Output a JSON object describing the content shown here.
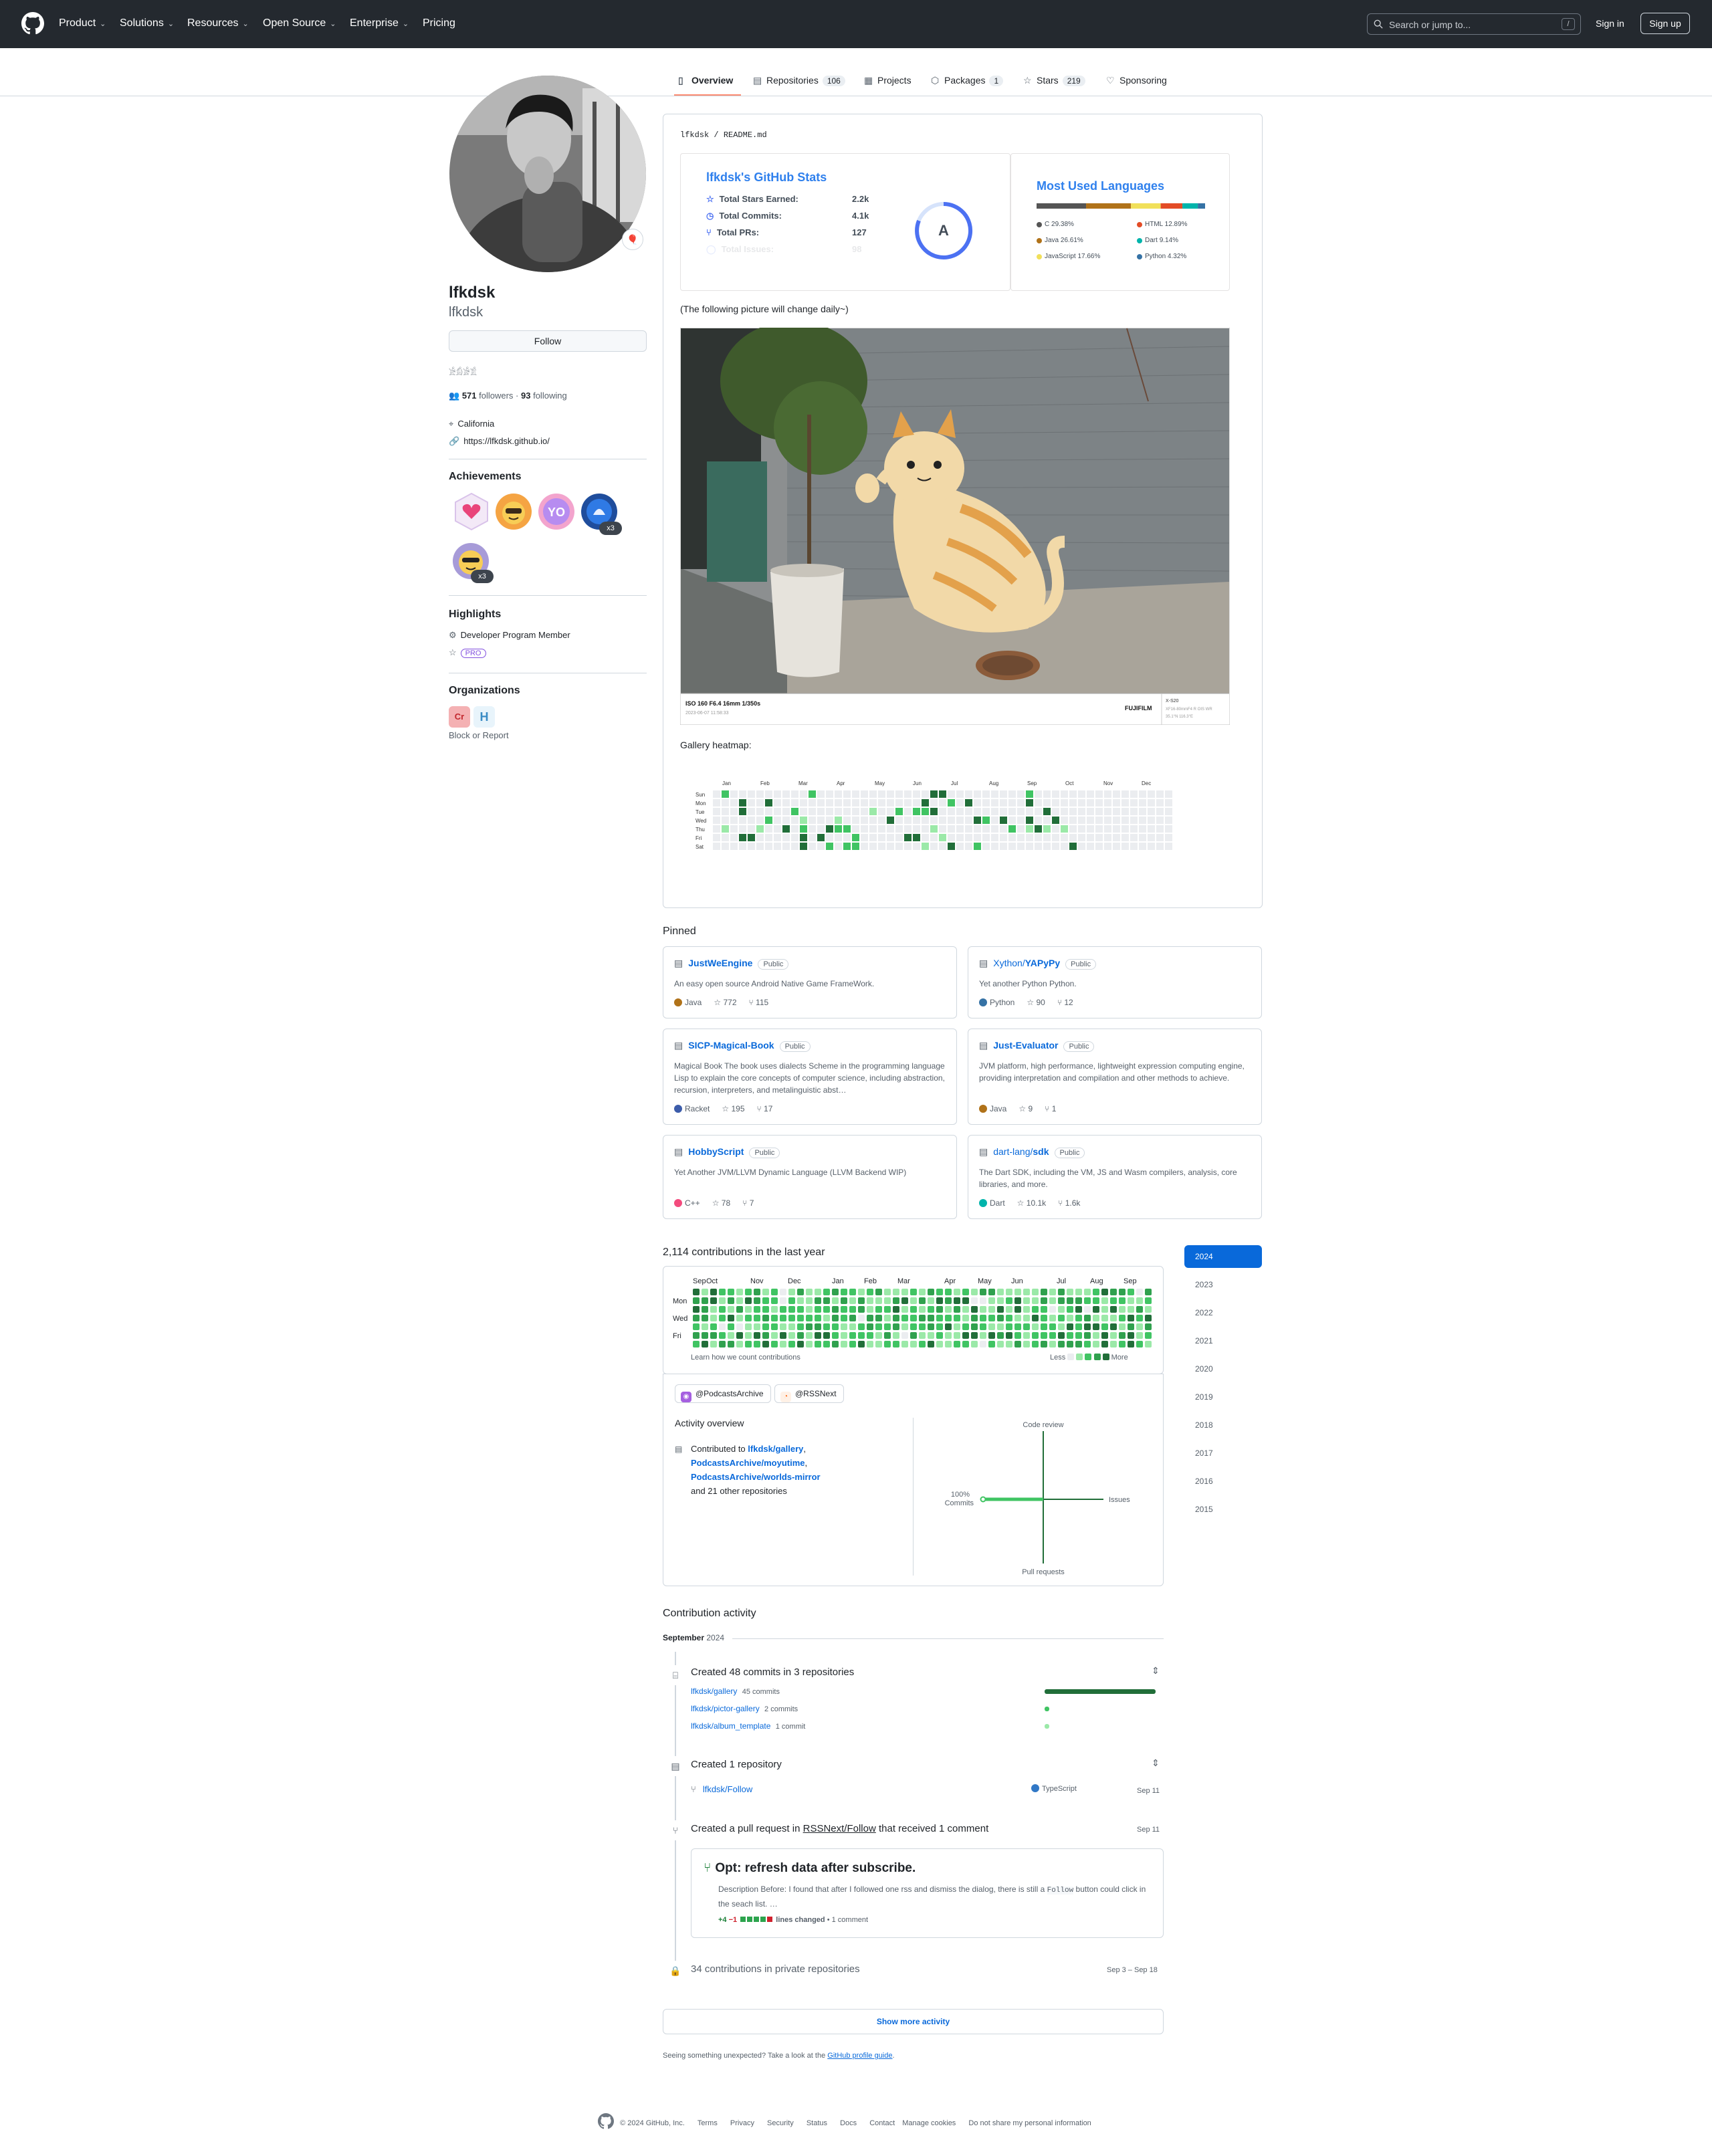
{
  "header": {
    "nav": [
      "Product",
      "Solutions",
      "Resources",
      "Open Source",
      "Enterprise",
      "Pricing"
    ],
    "search_placeholder": "Search or jump to...",
    "search_kbd": "/",
    "sign_in": "Sign in",
    "sign_up": "Sign up"
  },
  "tabs": [
    {
      "label": "Overview"
    },
    {
      "label": "Repositories",
      "count": "106"
    },
    {
      "label": "Projects"
    },
    {
      "label": "Packages",
      "count": "1"
    },
    {
      "label": "Stars",
      "count": "219"
    },
    {
      "label": "Sponsoring"
    }
  ],
  "profile": {
    "name": "lfkdsk",
    "login": "lfkdsk",
    "follow": "Follow",
    "bio": "𓀀𓀁𓀂𓀃",
    "followers": "571",
    "followers_label": "followers",
    "following": "93",
    "following_label": "following",
    "location": "California",
    "website": "https://lfkdsk.github.io/",
    "achievements_title": "Achievements",
    "achievement_counts": [
      "x3",
      "x3"
    ],
    "highlights_title": "Highlights",
    "highlight_member": "Developer Program Member",
    "highlight_pro": "PRO",
    "orgs_title": "Organizations",
    "block": "Block or Report"
  },
  "readme": {
    "path_owner": "lfkdsk",
    "path_file": "README.md",
    "note": "(The following picture will change daily~)",
    "heatmap_title": "Gallery heatmap:",
    "stats": {
      "title": "lfkdsk's GitHub Stats",
      "rows": [
        {
          "label": "Total Stars Earned:",
          "value": "2.2k"
        },
        {
          "label": "Total Commits:",
          "value": "4.1k"
        },
        {
          "label": "Total PRs:",
          "value": "127"
        },
        {
          "label": "Total Issues:",
          "value": "98"
        }
      ],
      "grade": "A"
    },
    "langs": {
      "title": "Most Used Languages",
      "items": [
        {
          "name": "C",
          "pct": "29.38%",
          "color": "#555555"
        },
        {
          "name": "Java",
          "pct": "26.61%",
          "color": "#b07219"
        },
        {
          "name": "JavaScript",
          "pct": "17.66%",
          "color": "#f1e05a"
        },
        {
          "name": "HTML",
          "pct": "12.89%",
          "color": "#e34c26"
        },
        {
          "name": "Dart",
          "pct": "9.14%",
          "color": "#00B4AB"
        },
        {
          "name": "Python",
          "pct": "4.32%",
          "color": "#3572A5"
        }
      ]
    },
    "photo": {
      "exif": "ISO 160 F6.4 16mm 1/350s",
      "date": "2023-06-07 11:58:33",
      "brand": "FUJIFILM",
      "model": "X-S20",
      "lens": "XF16-80mmF4 R OIS WR",
      "loc": "35.1°N 116.3°E"
    },
    "months": [
      "Jan",
      "Feb",
      "Mar",
      "Apr",
      "May",
      "Jun",
      "Jul",
      "Aug",
      "Sep",
      "Oct",
      "Nov",
      "Dec"
    ],
    "days": [
      "Sun",
      "Mon",
      "Tue",
      "Wed",
      "Thu",
      "Fri",
      "Sat"
    ]
  },
  "pinned": {
    "title": "Pinned",
    "items": [
      {
        "owner": "",
        "name": "JustWeEngine",
        "vis": "Public",
        "desc": "An easy open source Android Native Game FrameWork.",
        "lang": "Java",
        "color": "#b07219",
        "stars": "772",
        "forks": "115"
      },
      {
        "owner": "Xython/",
        "name": "YAPyPy",
        "vis": "Public",
        "desc": "Yet another Python Python.",
        "lang": "Python",
        "color": "#3572A5",
        "stars": "90",
        "forks": "12"
      },
      {
        "owner": "",
        "name": "SICP-Magical-Book",
        "vis": "Public",
        "desc": "Magical Book The book uses dialects Scheme in the programming language Lisp to explain the core concepts of computer science, including abstraction, recursion, interpreters, and metalinguistic abst…",
        "lang": "Racket",
        "color": "#3c5caa",
        "stars": "195",
        "forks": "17"
      },
      {
        "owner": "",
        "name": "Just-Evaluator",
        "vis": "Public",
        "desc": "JVM platform, high performance, lightweight expression computing engine, providing interpretation and compilation and other methods to achieve.",
        "lang": "Java",
        "color": "#b07219",
        "stars": "9",
        "forks": "1"
      },
      {
        "owner": "",
        "name": "HobbyScript",
        "vis": "Public",
        "desc": "Yet Another JVM/LLVM Dynamic Language (LLVM Backend WIP)",
        "lang": "C++",
        "color": "#f34b7d",
        "stars": "78",
        "forks": "7"
      },
      {
        "owner": "dart-lang/",
        "name": "sdk",
        "vis": "Public",
        "desc": "The Dart SDK, including the VM, JS and Wasm compilers, analysis, core libraries, and more.",
        "lang": "Dart",
        "color": "#00B4AB",
        "stars": "10.1k",
        "forks": "1.6k"
      }
    ]
  },
  "contrib": {
    "title": "2,114 contributions in the last year",
    "months": [
      "Sep",
      "Oct",
      "Nov",
      "Dec",
      "Jan",
      "Feb",
      "Mar",
      "Apr",
      "May",
      "Jun",
      "Jul",
      "Aug",
      "Sep"
    ],
    "days": [
      "Mon",
      "Wed",
      "Fri"
    ],
    "learn": "Learn how we count contributions",
    "less": "Less",
    "more": "More",
    "orgs": [
      "@PodcastsArchive",
      "@RSSNext"
    ],
    "overview_title": "Activity overview",
    "contributed_prefix": "Contributed to",
    "repo1": "lfkdsk/gallery",
    "repo2": "PodcastsArchive/moyutime",
    "repo3": "PodcastsArchive/worlds-mirror",
    "other": "and 21 other repositories",
    "axes": {
      "top": "Code review",
      "right": "Issues",
      "bottom": "Pull requests",
      "left": "Commits",
      "left_pct": "100%"
    }
  },
  "years": [
    "2024",
    "2023",
    "2022",
    "2021",
    "2020",
    "2019",
    "2018",
    "2017",
    "2016",
    "2015"
  ],
  "activity": {
    "title": "Contribution activity",
    "month": "September",
    "year": "2024",
    "commits_title": "Created 48 commits in 3 repositories",
    "commit_repos": [
      {
        "name": "lfkdsk/gallery",
        "count": "45 commits",
        "pct": 1.0
      },
      {
        "name": "lfkdsk/pictor-gallery",
        "count": "2 commits",
        "pct": 0.04
      },
      {
        "name": "lfkdsk/album_template",
        "count": "1 commit",
        "pct": 0.02
      }
    ],
    "repo_title": "Created 1 repository",
    "new_repo": "lfkdsk/Follow",
    "new_repo_lang": "TypeScript",
    "new_repo_date": "Sep 11",
    "pr_prefix": "Created a pull request in",
    "pr_repo": "RSSNext/Follow",
    "pr_suffix": "that received 1 comment",
    "pr_date": "Sep 11",
    "pr_title": "Opt: refresh data after subscribe.",
    "pr_desc1": "Description Before: I found that after I followed one rss and dismiss the dialog, there is still a",
    "pr_code": "Follow",
    "pr_desc2": "button could click in the seach list. …",
    "pr_add": "+4",
    "pr_del": "−1",
    "pr_lines": "lines changed",
    "pr_comments": "• 1 comment",
    "private": "34 contributions in private repositories",
    "private_date": "Sep 3 – Sep 18",
    "show_more": "Show more activity",
    "unexpected": "Seeing something unexpected? Take a look at the",
    "guide": "GitHub profile guide",
    "guide_end": "."
  },
  "footer": {
    "copyright": "© 2024 GitHub, Inc.",
    "links": [
      "Terms",
      "Privacy",
      "Security",
      "Status",
      "Docs",
      "Contact",
      "Manage cookies",
      "Do not share my personal information"
    ]
  }
}
